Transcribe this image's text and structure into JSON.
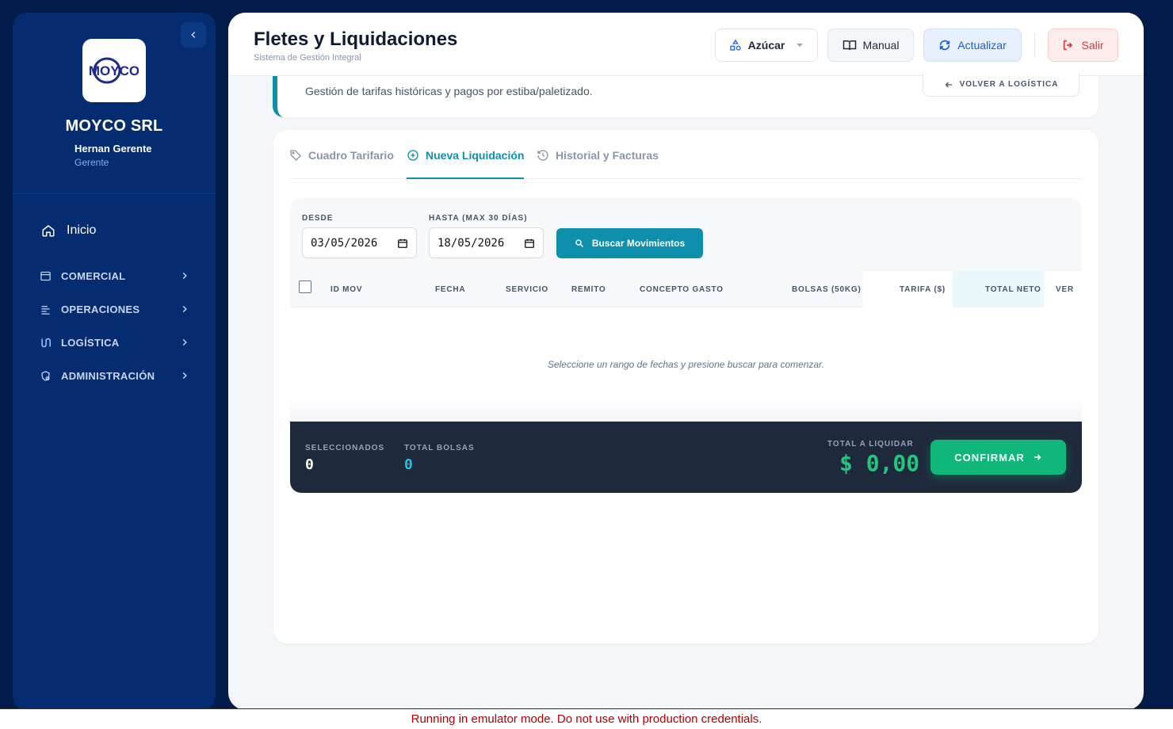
{
  "sidebar": {
    "logo_text": "MOYCO",
    "brand": "MOYCO SRL",
    "user_name": "Hernan Gerente",
    "user_role": "Gerente",
    "home": "Inicio",
    "items": [
      {
        "label": "COMERCIAL",
        "icon": "store-icon"
      },
      {
        "label": "OPERACIONES",
        "icon": "layers-icon"
      },
      {
        "label": "LOGÍSTICA",
        "icon": "route-icon"
      },
      {
        "label": "ADMINISTRACIÓN",
        "icon": "shield-cog-icon"
      }
    ]
  },
  "header": {
    "title": "Fletes y Liquidaciones",
    "subtitle": "Sistema de Gestión Integral",
    "azucar": "Azúcar",
    "manual": "Manual",
    "actualizar": "Actualizar",
    "salir": "Salir"
  },
  "head_card": {
    "description": "Gestión de tarifas históricas y pagos por estiba/paletizado.",
    "back_label": "VOLVER A LOGÍSTICA"
  },
  "tabs": [
    {
      "label": "Cuadro Tarifario",
      "active": false
    },
    {
      "label": "Nueva Liquidación",
      "active": true
    },
    {
      "label": "Historial y Facturas",
      "active": false
    }
  ],
  "filters": {
    "desde_label": "DESDE",
    "desde_value": "03/05/2026",
    "hasta_label": "HASTA (MAX 30 DÍAS)",
    "hasta_value": "18/05/2026",
    "search_label": "Buscar Movimientos"
  },
  "table": {
    "columns": [
      "ID MOV",
      "FECHA",
      "SERVICIO",
      "REMITO",
      "CONCEPTO GASTO",
      "BOLSAS (50KG)",
      "TARIFA ($)",
      "TOTAL NETO",
      "VER"
    ],
    "empty_message": "Seleccione un rango de fechas y presione buscar para comenzar."
  },
  "summary": {
    "seleccionados_label": "SELECCIONADOS",
    "seleccionados_value": "0",
    "total_bolsas_label": "TOTAL BOLSAS",
    "total_bolsas_value": "0",
    "total_label": "TOTAL A LIQUIDAR",
    "total_value": "$ 0,00",
    "confirm_label": "CONFIRMAR"
  },
  "emulator_notice": "Running in emulator mode. Do not use with production credentials.",
  "colors": {
    "accent": "#0e8fab",
    "sidebar": "#052c70",
    "success": "#10b67a",
    "danger": "#d63a3a"
  }
}
